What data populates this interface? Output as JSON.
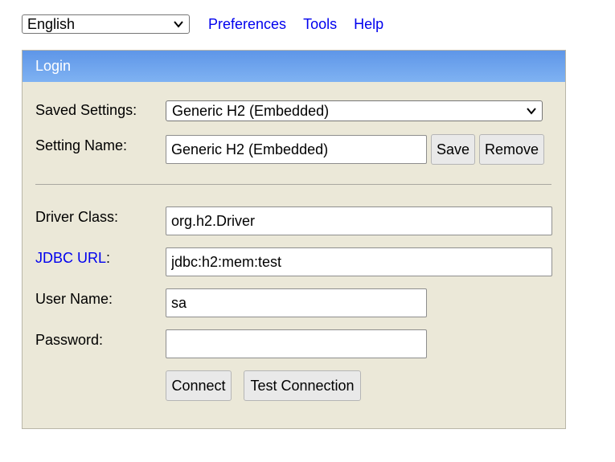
{
  "topbar": {
    "language": "English",
    "links": [
      "Preferences",
      "Tools",
      "Help"
    ]
  },
  "login": {
    "title": "Login",
    "saved_settings_label": "Saved Settings:",
    "saved_settings_value": "Generic H2 (Embedded)",
    "setting_name_label": "Setting Name:",
    "setting_name_value": "Generic H2 (Embedded)",
    "save_label": "Save",
    "remove_label": "Remove",
    "driver_class_label": "Driver Class:",
    "driver_class_value": "org.h2.Driver",
    "jdbc_url_link": "JDBC URL",
    "jdbc_url_colon": ":",
    "jdbc_url_value": "jdbc:h2:mem:test",
    "user_name_label": "User Name:",
    "user_name_value": "sa",
    "password_label": "Password:",
    "password_value": "",
    "connect_label": "Connect",
    "test_connection_label": "Test Connection"
  },
  "colors": {
    "header_blue": "#6fa3ee",
    "panel_bg": "#ebe8d8",
    "link": "#0000ee"
  },
  "icons": {
    "dropdown": "chevron-down-icon"
  }
}
